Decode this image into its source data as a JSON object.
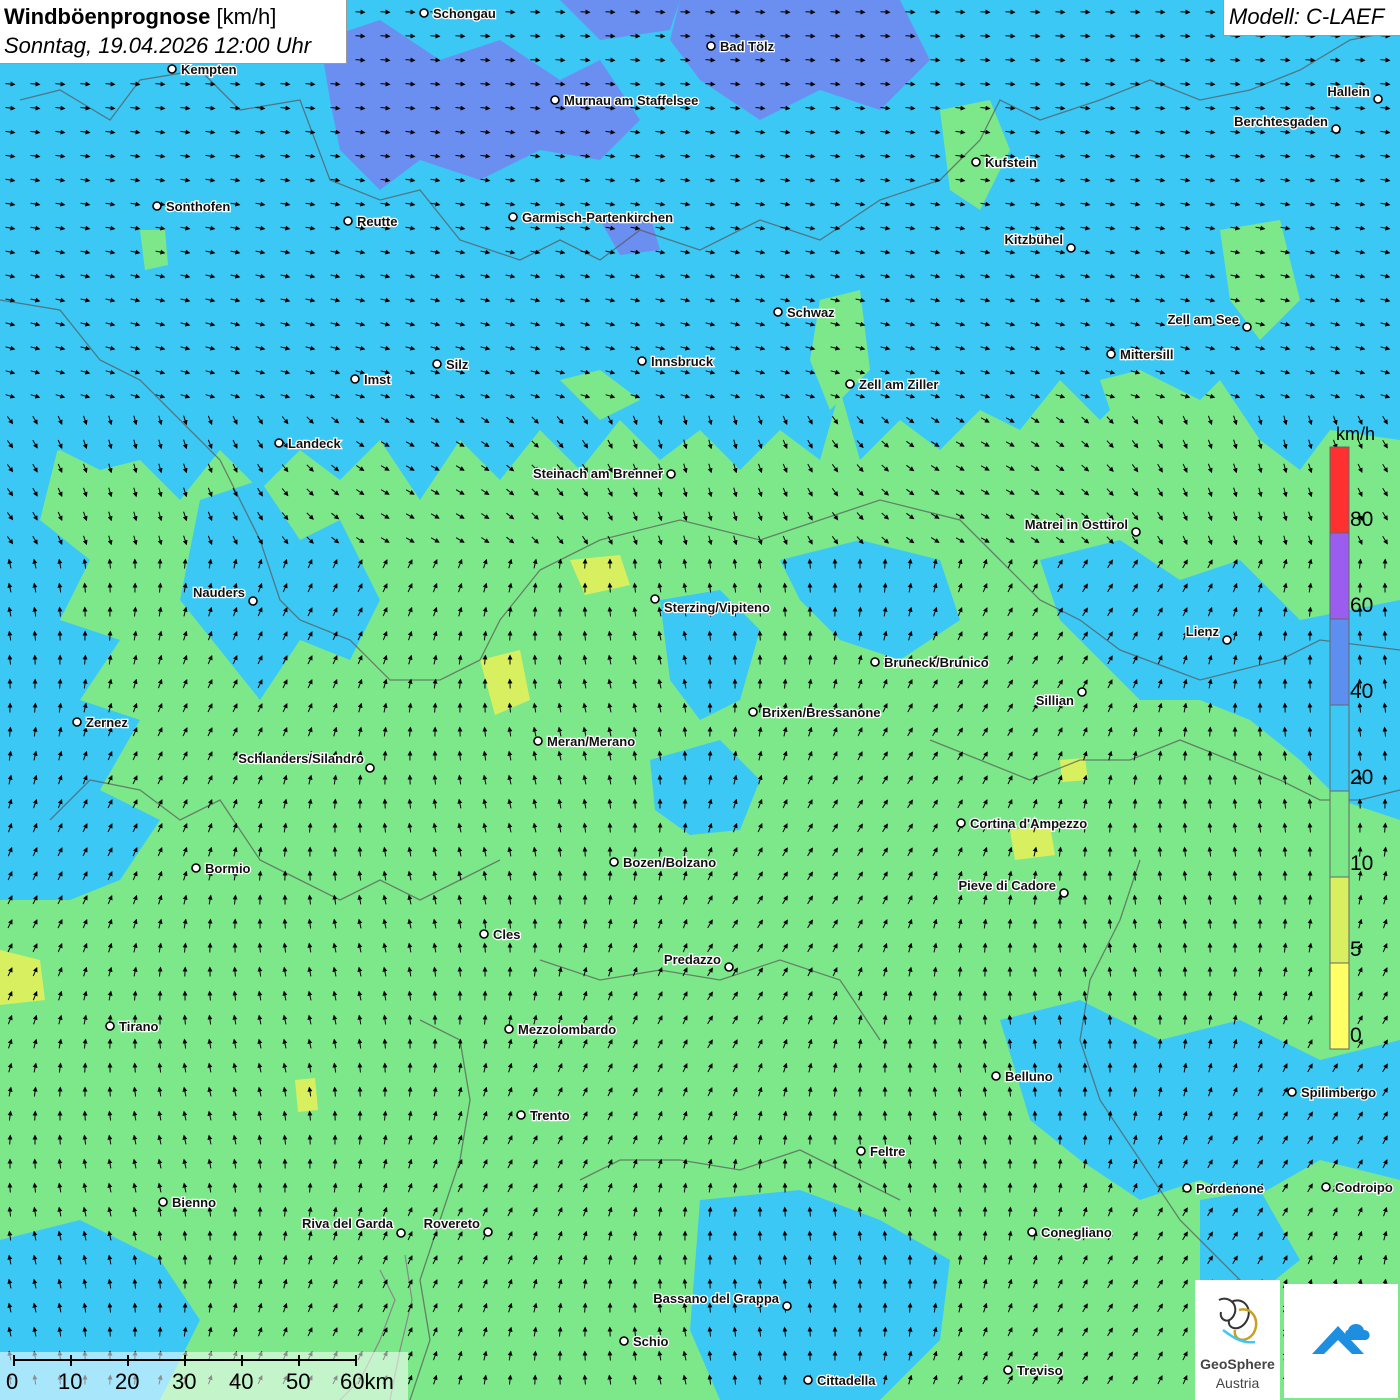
{
  "title": {
    "main": "Windböenprognose",
    "unit": "[km/h]",
    "datetime": "Sonntag, 19.04.2026 12:00 Uhr"
  },
  "model": "Modell: C-LAEF",
  "legend": {
    "unit": "km/h",
    "labels": [
      "80",
      "60",
      "40",
      "20",
      "10",
      "5",
      "0"
    ],
    "colors": [
      "#ff3030",
      "#9b5cf0",
      "#5c8ff0",
      "#3cc8f5",
      "#7de88a",
      "#d8f060",
      "#ffff66"
    ]
  },
  "scale_bar": {
    "labels": [
      "0",
      "10",
      "20",
      "30",
      "40",
      "50",
      "60km"
    ]
  },
  "logo": {
    "name": "GeoSphere",
    "sub": "Austria"
  },
  "palette": {
    "calm": "#7de88a",
    "moderate": "#3cc8f5",
    "strong": "#6b8ff0",
    "weak": "#d8f060"
  },
  "cities": [
    {
      "name": "Schongau"
    },
    {
      "name": "Kempten"
    },
    {
      "name": "Bad Tölz"
    },
    {
      "name": "Murnau am Staffelsee"
    },
    {
      "name": "Hallein"
    },
    {
      "name": "Berchtesgaden"
    },
    {
      "name": "Kufstein"
    },
    {
      "name": "Sonthofen"
    },
    {
      "name": "Reutte"
    },
    {
      "name": "Garmisch-Partenkirchen"
    },
    {
      "name": "Kitzbühel"
    },
    {
      "name": "Schwaz"
    },
    {
      "name": "Zell am See"
    },
    {
      "name": "Innsbruck"
    },
    {
      "name": "Mittersill"
    },
    {
      "name": "Silz"
    },
    {
      "name": "Imst"
    },
    {
      "name": "Zell am Ziller"
    },
    {
      "name": "Landeck"
    },
    {
      "name": "Steinach am Brenner"
    },
    {
      "name": "Matrei in Osttirol"
    },
    {
      "name": "Nauders"
    },
    {
      "name": "Sterzing/Vipiteno"
    },
    {
      "name": "Lienz"
    },
    {
      "name": "Bruneck/Brunico"
    },
    {
      "name": "Sillian"
    },
    {
      "name": "Zernez"
    },
    {
      "name": "Brixen/Bressanone"
    },
    {
      "name": "Meran/Merano"
    },
    {
      "name": "Schlanders/Silandro"
    },
    {
      "name": "Cortina d'Ampezzo"
    },
    {
      "name": "Bozen/Bolzano"
    },
    {
      "name": "Bormio"
    },
    {
      "name": "Pieve di Cadore"
    },
    {
      "name": "Cles"
    },
    {
      "name": "Predazzo"
    },
    {
      "name": "Tirano"
    },
    {
      "name": "Mezzolombardo"
    },
    {
      "name": "Belluno"
    },
    {
      "name": "Spilimbergo"
    },
    {
      "name": "Trento"
    },
    {
      "name": "Feltre"
    },
    {
      "name": "Pordenone"
    },
    {
      "name": "Codroipo"
    },
    {
      "name": "Bienno"
    },
    {
      "name": "Riva del Garda"
    },
    {
      "name": "Rovereto"
    },
    {
      "name": "Conegliano"
    },
    {
      "name": "Bassano del Grappa"
    },
    {
      "name": "Schio"
    },
    {
      "name": "Treviso"
    },
    {
      "name": "Cittadella"
    }
  ]
}
